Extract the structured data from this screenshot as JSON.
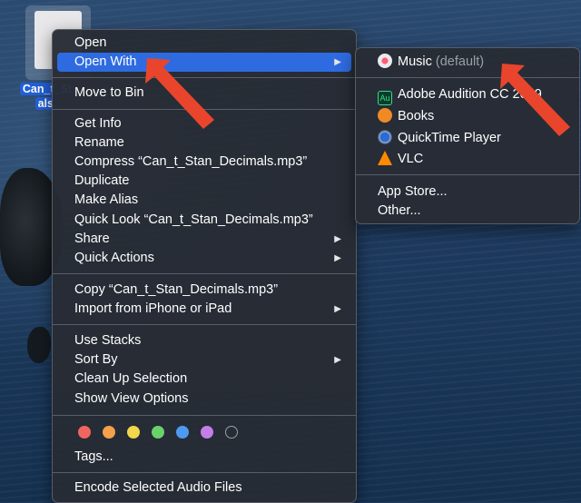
{
  "desktop": {
    "file_label_line1": "Can_t_St",
    "file_label_line2": "als."
  },
  "main_menu": {
    "open": "Open",
    "open_with": "Open With",
    "move_to_bin": "Move to Bin",
    "get_info": "Get Info",
    "rename": "Rename",
    "compress": "Compress “Can_t_Stan_Decimals.mp3”",
    "duplicate": "Duplicate",
    "make_alias": "Make Alias",
    "quick_look": "Quick Look “Can_t_Stan_Decimals.mp3”",
    "share": "Share",
    "quick_actions": "Quick Actions",
    "copy": "Copy “Can_t_Stan_Decimals.mp3”",
    "import": "Import from iPhone or iPad",
    "use_stacks": "Use Stacks",
    "sort_by": "Sort By",
    "clean_up": "Clean Up Selection",
    "show_view_options": "Show View Options",
    "tags": "Tags...",
    "encode": "Encode Selected Audio Files",
    "submenu_arrow": "▶",
    "tag_colors": [
      "#f0665f",
      "#f5a04a",
      "#f2d64c",
      "#6ad06c",
      "#4d9bf0",
      "#c47ee8",
      "none"
    ]
  },
  "open_with_menu": {
    "music": "Music",
    "music_default": "(default)",
    "adobe_audition": "Adobe Audition CC 2019",
    "adobe_icon_text": "Au",
    "books": "Books",
    "quicktime": "QuickTime Player",
    "vlc": "VLC",
    "app_store": "App Store...",
    "other": "Other..."
  },
  "colors": {
    "highlight": "#2f6be0",
    "annotation_arrow": "#e8452c"
  }
}
